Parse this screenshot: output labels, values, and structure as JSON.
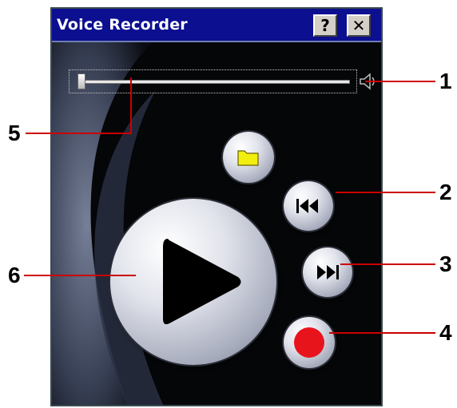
{
  "window": {
    "title": "Voice Recorder",
    "help_label": "?",
    "close_label": "✕"
  },
  "slider": {
    "position": 0
  },
  "icons": {
    "folder": "folder-icon",
    "skip_back": "skip-back-icon",
    "skip_forward": "skip-forward-icon",
    "record": "record-icon",
    "play": "play-icon",
    "volume": "speaker-icon"
  },
  "callouts": {
    "c1": "1",
    "c2": "2",
    "c3": "3",
    "c4": "4",
    "c5": "5",
    "c6": "6"
  },
  "colors": {
    "titlebar": "#0c0f8f",
    "record": "#e8141c",
    "folder": "#f2ee10",
    "callout_line": "#cc0000"
  }
}
